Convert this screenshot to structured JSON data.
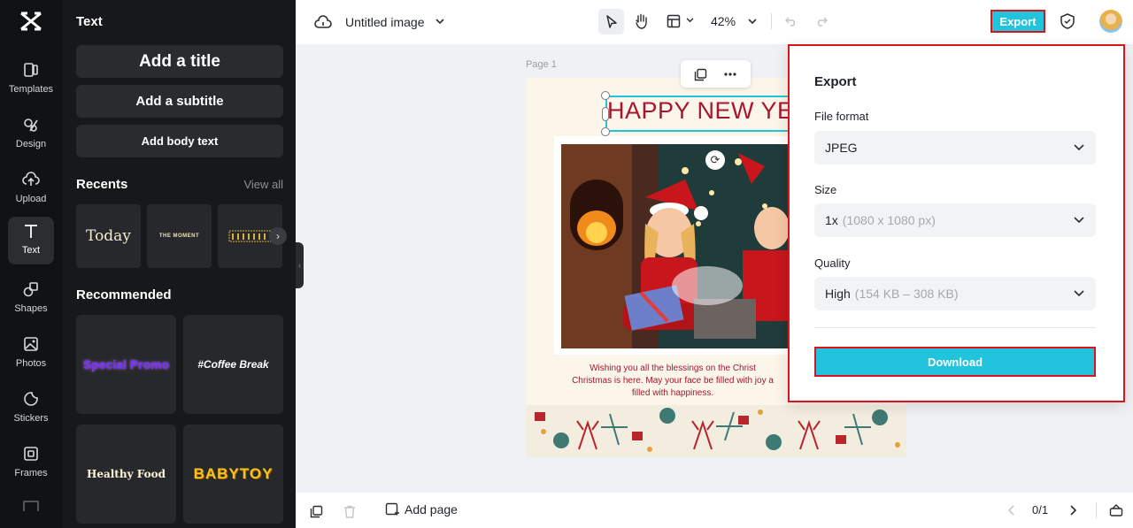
{
  "rail": {
    "items": [
      {
        "label": "Templates",
        "icon": "templates-icon"
      },
      {
        "label": "Design",
        "icon": "design-icon"
      },
      {
        "label": "Upload",
        "icon": "upload-icon"
      },
      {
        "label": "Text",
        "icon": "text-icon"
      },
      {
        "label": "Shapes",
        "icon": "shapes-icon"
      },
      {
        "label": "Photos",
        "icon": "photos-icon"
      },
      {
        "label": "Stickers",
        "icon": "stickers-icon"
      },
      {
        "label": "Frames",
        "icon": "frames-icon"
      }
    ]
  },
  "panel": {
    "title": "Text",
    "add_title": "Add a title",
    "add_subtitle": "Add a subtitle",
    "add_body": "Add body text",
    "recents_label": "Recents",
    "view_all": "View all",
    "recents": [
      "Today",
      "THE MOMENT"
    ],
    "recommended_label": "Recommended",
    "recommended": [
      "Special Promo",
      "#Coffee Break",
      "Healthy Food",
      "BABYTOY"
    ]
  },
  "topbar": {
    "doc_title": "Untitled image",
    "zoom": "42%",
    "export_label": "Export"
  },
  "canvas": {
    "page_label": "Page 1",
    "headline": "HAPPY NEW YE",
    "wish_lines": [
      "Wishing you all the blessings on the Christ",
      "Christmas is here. May your face be filled with joy a",
      "filled with happiness."
    ]
  },
  "bottombar": {
    "add_page": "Add page",
    "page_count": "0/1"
  },
  "export_dialog": {
    "title": "Export",
    "file_format_label": "File format",
    "file_format_value": "JPEG",
    "size_label": "Size",
    "size_value": "1x",
    "size_hint": "(1080 x 1080 px)",
    "quality_label": "Quality",
    "quality_value": "High",
    "quality_hint": "(154 KB – 308 KB)",
    "download_label": "Download"
  },
  "colors": {
    "accent": "#22c3dc",
    "highlight_border": "#d9141c",
    "headline": "#a6172d"
  }
}
